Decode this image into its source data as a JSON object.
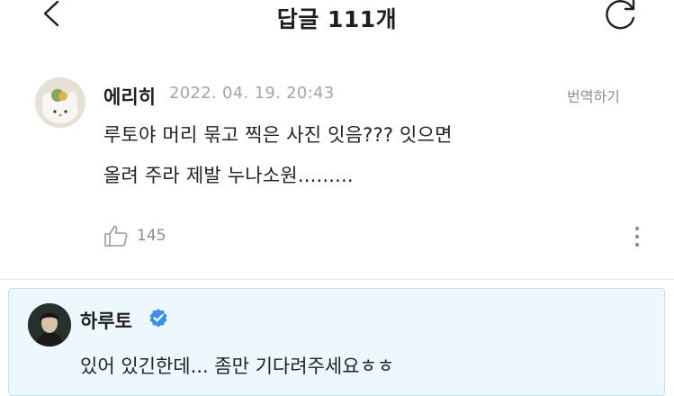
{
  "header": {
    "title": "답글 111개",
    "back_icon": "chevron-left-icon",
    "refresh_icon": "refresh-icon"
  },
  "comment": {
    "author": "에리히",
    "date": "2022. 04. 19. 20:43",
    "translate_label": "번역하기",
    "lines": [
      "루토야 머리 묶고 찍은 사진 잇음??? 잇으면",
      "올려 주라 제발 누나소원........."
    ],
    "like_count": "145",
    "like_icon": "thumbs-up-icon",
    "more_icon": "more-vertical-icon"
  },
  "reply": {
    "author": "하루토",
    "verified_icon": "verified-badge-icon",
    "text": "있어 있긴한데... 좀만 기다려주세요ㅎㅎ"
  },
  "colors": {
    "reply_background": "#ecf8fd",
    "reply_border": "#bfe3f2",
    "verified_badge": "#3b8fe6",
    "meta_text": "#a5a5a5"
  }
}
